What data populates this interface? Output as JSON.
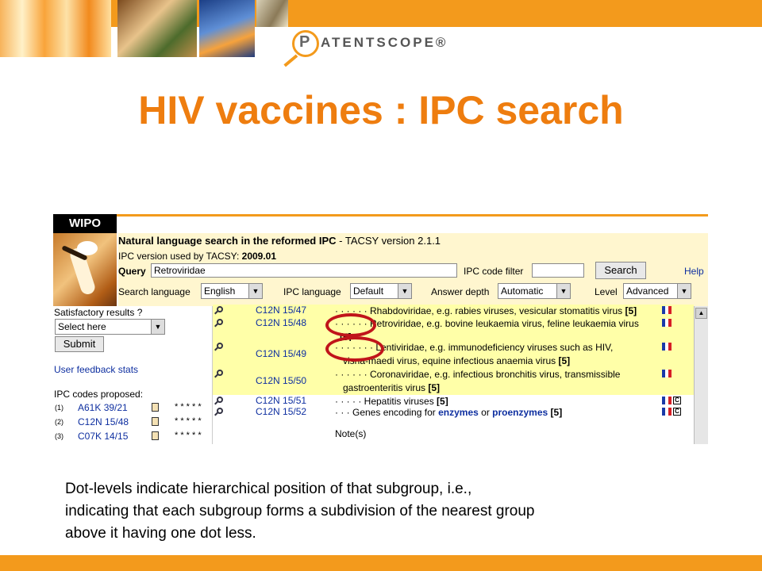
{
  "slide": {
    "title": "HIV vaccines : IPC search",
    "logo_text": "ATENTSCOPE®",
    "logo_letter": "P",
    "accent_color": "#ee7d0f",
    "body_lines": [
      "Dot-levels indicate hierarchical position of that subgroup, i.e.,",
      "indicating that each subgroup forms a subdivision of the nearest group",
      "above it having one dot less."
    ]
  },
  "app": {
    "org": "WIPO",
    "title": "Natural language search in the reformed IPC",
    "title_suffix": " - TACSY version 2.1.1",
    "ipc_version_label": "IPC version used by TACSY:",
    "ipc_version_value": "2009.01",
    "query_label": "Query",
    "query_value": "Retroviridae",
    "code_filter_label": "IPC code filter",
    "code_filter_value": "",
    "search_button": "Search",
    "help_link": "Help",
    "search_language_label": "Search language",
    "search_language_value": "English",
    "ipc_language_label": "IPC language",
    "ipc_language_value": "Default",
    "answer_depth_label": "Answer depth",
    "answer_depth_value": "Automatic",
    "level_label": "Level",
    "level_value": "Advanced"
  },
  "left": {
    "satisfactory_label": "Satisfactory results ?",
    "select_value": "Select here",
    "submit_button": "Submit",
    "feedback_link": "User feedback stats",
    "proposed_label": "IPC codes proposed:",
    "proposed": [
      {
        "num": "(1)",
        "code": "A61K 39/21",
        "stars": "* * * * *"
      },
      {
        "num": "(2)",
        "code": "C12N 15/48",
        "stars": "* * * * *"
      },
      {
        "num": "(3)",
        "code": "C07K 14/15",
        "stars": "* * * * *"
      }
    ]
  },
  "results": [
    {
      "code": "C12N 15/47",
      "dots": "· · · · · ·",
      "line1": "Rhabdoviridae, e.g. rabies viruses, vesicular stomatitis virus",
      "count1": "[5]",
      "line2": "",
      "count2": "",
      "flag": "fr",
      "c": false
    },
    {
      "code": "C12N 15/48",
      "dots": "· · · · · ·",
      "line1": "Retroviridae, e.g. bovine leukaemia virus, feline leukaemia virus",
      "count1": "",
      "line2": "",
      "count2": "[5]",
      "flag": "fr",
      "c": false
    },
    {
      "code": "C12N 15/49",
      "dots": "· · · · · · ·",
      "line1": "Lentiviridae, e.g. immunodeficiency viruses such as HIV,",
      "count1": "",
      "line2": "visna-maedi virus, equine infectious anaemia virus",
      "count2": "[5]",
      "flag": "fr",
      "c": false
    },
    {
      "code": "C12N 15/50",
      "dots": "· · · · · ·",
      "line1": "Coronaviridae, e.g. infectious bronchitis virus, transmissible",
      "count1": "",
      "line2": "gastroenteritis virus",
      "count2": "[5]",
      "flag": "fr",
      "c": false
    },
    {
      "code": "C12N 15/51",
      "dots": "· · · · ·",
      "line1": "Hepatitis viruses",
      "count1": "[5]",
      "line2": "",
      "count2": "",
      "flag": "fr",
      "c": true
    },
    {
      "code": "C12N 15/52",
      "dots": "· · ·",
      "line1": "Genes encoding for",
      "enz": "enzymes",
      "or": "or",
      "proenz": "proenzymes",
      "count1": "[5]",
      "flag": "fr",
      "c": true
    }
  ],
  "notes_label": "Note(s)",
  "c_flag_letter": "C"
}
